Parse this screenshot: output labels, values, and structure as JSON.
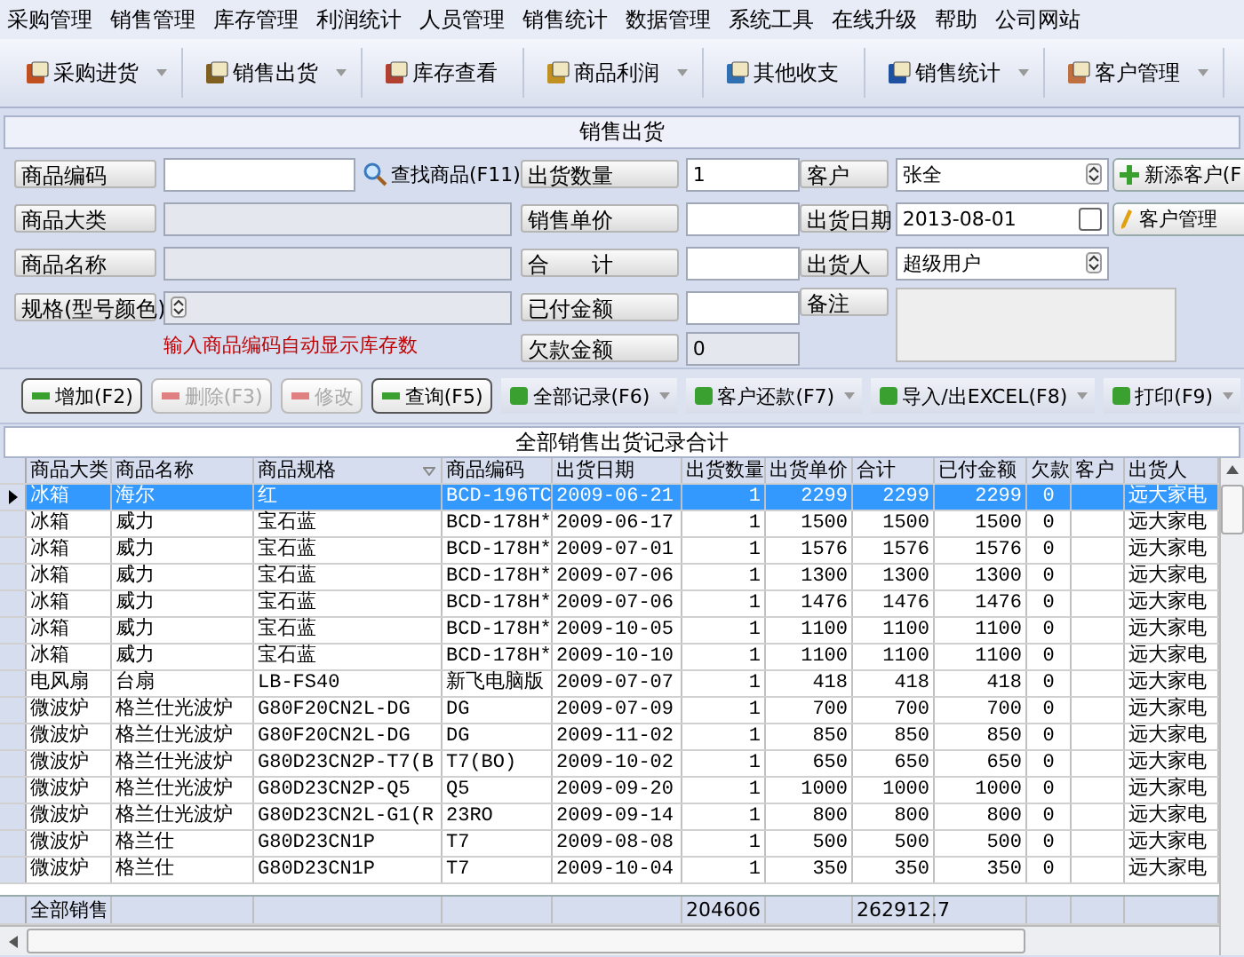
{
  "menu": [
    "采购管理",
    "销售管理",
    "库存管理",
    "利润统计",
    "人员管理",
    "销售统计",
    "数据管理",
    "系统工具",
    "在线升级",
    "帮助",
    "公司网站"
  ],
  "toolbar": [
    {
      "label": "采购进货",
      "dropdown": true
    },
    {
      "label": "销售出货",
      "dropdown": true
    },
    {
      "label": "库存查看",
      "dropdown": false
    },
    {
      "label": "商品利润",
      "dropdown": true
    },
    {
      "label": "其他收支",
      "dropdown": false
    },
    {
      "label": "销售统计",
      "dropdown": true
    },
    {
      "label": "客户管理",
      "dropdown": true
    }
  ],
  "panel_title": "销售出货",
  "form": {
    "product_code_label": "商品编码",
    "find_button": "查找商品(F11)",
    "category_label": "商品大类",
    "name_label": "商品名称",
    "spec_label": "规格(型号颜色)",
    "hint": "输入商品编码自动显示库存数",
    "quantity": {
      "label": "出货数量",
      "value": "1"
    },
    "unit_price_label": "销售单价",
    "total_label": "合　　计",
    "paid_label": "已付金额",
    "debt": {
      "label": "欠款金额",
      "value": "0"
    },
    "customer": {
      "label": "客户",
      "value": "张全"
    },
    "date": {
      "label": "出货日期",
      "value": "2013-08-01",
      "checked": false
    },
    "seller": {
      "label": "出货人",
      "value": "超级用户"
    },
    "note_label": "备注",
    "add_customer_button": "新添客户(F",
    "manage_customer_button": "客户管理"
  },
  "actions": [
    {
      "label": "增加(F2)",
      "kind": "button",
      "disabled": false
    },
    {
      "label": "删除(F3)",
      "kind": "button",
      "disabled": true
    },
    {
      "label": "修改",
      "kind": "button",
      "disabled": true
    },
    {
      "label": "查询(F5)",
      "kind": "button",
      "disabled": false
    },
    {
      "label": "全部记录(F6)",
      "kind": "menu",
      "disabled": false
    },
    {
      "label": "客户还款(F7)",
      "kind": "menu",
      "disabled": false
    },
    {
      "label": "导入/出EXCEL(F8)",
      "kind": "menu",
      "disabled": false
    },
    {
      "label": "打印(F9)",
      "kind": "menu",
      "disabled": false
    }
  ],
  "grid_title": "全部销售出货记录合计",
  "table": {
    "columns": [
      {
        "label": "商品大类",
        "kind": "text",
        "sorted": false
      },
      {
        "label": "商品名称",
        "kind": "text",
        "sorted": false
      },
      {
        "label": "商品规格",
        "kind": "text",
        "sorted": true
      },
      {
        "label": "商品编码",
        "kind": "text",
        "sorted": false
      },
      {
        "label": "出货日期",
        "kind": "text",
        "sorted": false
      },
      {
        "label": "出货数量",
        "kind": "number",
        "sorted": false
      },
      {
        "label": "出货单价",
        "kind": "number",
        "sorted": false
      },
      {
        "label": "合计",
        "kind": "number",
        "sorted": false
      },
      {
        "label": "已付金额",
        "kind": "number",
        "sorted": false
      },
      {
        "label": "欠款",
        "kind": "flag",
        "sorted": false
      },
      {
        "label": "客户",
        "kind": "text",
        "sorted": false
      },
      {
        "label": "出货人",
        "kind": "text",
        "sorted": false
      }
    ],
    "rows": [
      {
        "selected": true,
        "cells": [
          "冰箱",
          "海尔",
          "红",
          "BCD-196TC",
          "2009-06-21",
          "1",
          "2299",
          "2299",
          "2299",
          "0",
          "",
          "远大家电"
        ]
      },
      {
        "selected": false,
        "cells": [
          "冰箱",
          "威力",
          "宝石蓝",
          "BCD-178H*",
          "2009-06-17",
          "1",
          "1500",
          "1500",
          "1500",
          "0",
          "",
          "远大家电"
        ]
      },
      {
        "selected": false,
        "cells": [
          "冰箱",
          "威力",
          "宝石蓝",
          "BCD-178H*",
          "2009-07-01",
          "1",
          "1576",
          "1576",
          "1576",
          "0",
          "",
          "远大家电"
        ]
      },
      {
        "selected": false,
        "cells": [
          "冰箱",
          "威力",
          "宝石蓝",
          "BCD-178H*",
          "2009-07-06",
          "1",
          "1300",
          "1300",
          "1300",
          "0",
          "",
          "远大家电"
        ]
      },
      {
        "selected": false,
        "cells": [
          "冰箱",
          "威力",
          "宝石蓝",
          "BCD-178H*",
          "2009-07-06",
          "1",
          "1476",
          "1476",
          "1476",
          "0",
          "",
          "远大家电"
        ]
      },
      {
        "selected": false,
        "cells": [
          "冰箱",
          "威力",
          "宝石蓝",
          "BCD-178H*",
          "2009-10-05",
          "1",
          "1100",
          "1100",
          "1100",
          "0",
          "",
          "远大家电"
        ]
      },
      {
        "selected": false,
        "cells": [
          "冰箱",
          "威力",
          "宝石蓝",
          "BCD-178H*",
          "2009-10-10",
          "1",
          "1100",
          "1100",
          "1100",
          "0",
          "",
          "远大家电"
        ]
      },
      {
        "selected": false,
        "cells": [
          "电风扇",
          "台扇",
          "LB-FS40",
          "新飞电脑版",
          "2009-07-07",
          "1",
          "418",
          "418",
          "418",
          "0",
          "",
          "远大家电"
        ]
      },
      {
        "selected": false,
        "cells": [
          "微波炉",
          "格兰仕光波炉",
          "G80F20CN2L-DG",
          "DG",
          "2009-07-09",
          "1",
          "700",
          "700",
          "700",
          "0",
          "",
          "远大家电"
        ]
      },
      {
        "selected": false,
        "cells": [
          "微波炉",
          "格兰仕光波炉",
          "G80F20CN2L-DG",
          "DG",
          "2009-11-02",
          "1",
          "850",
          "850",
          "850",
          "0",
          "",
          "远大家电"
        ]
      },
      {
        "selected": false,
        "cells": [
          "微波炉",
          "格兰仕光波炉",
          "G80D23CN2P-T7(B",
          "T7(BO)",
          "2009-10-02",
          "1",
          "650",
          "650",
          "650",
          "0",
          "",
          "远大家电"
        ]
      },
      {
        "selected": false,
        "cells": [
          "微波炉",
          "格兰仕光波炉",
          "G80D23CN2P-Q5",
          "Q5",
          "2009-09-20",
          "1",
          "1000",
          "1000",
          "1000",
          "0",
          "",
          "远大家电"
        ]
      },
      {
        "selected": false,
        "cells": [
          "微波炉",
          "格兰仕光波炉",
          "G80D23CN2L-G1(R",
          "23RO",
          "2009-09-14",
          "1",
          "800",
          "800",
          "800",
          "0",
          "",
          "远大家电"
        ]
      },
      {
        "selected": false,
        "cells": [
          "微波炉",
          "格兰仕",
          "G80D23CN1P",
          "T7",
          "2009-08-08",
          "1",
          "500",
          "500",
          "500",
          "0",
          "",
          "远大家电"
        ]
      },
      {
        "selected": false,
        "cells": [
          "微波炉",
          "格兰仕",
          "G80D23CN1P",
          "T7",
          "2009-10-04",
          "1",
          "350",
          "350",
          "350",
          "0",
          "",
          "远大家电"
        ]
      }
    ],
    "footer": {
      "label": "全部销售",
      "quantity": "204606",
      "total": "262912.7"
    }
  }
}
